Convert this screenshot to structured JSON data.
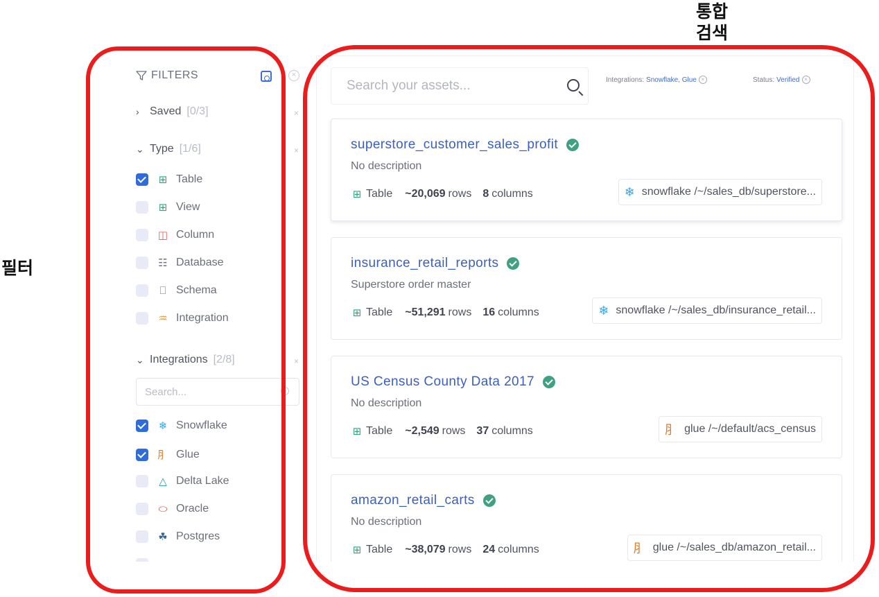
{
  "annotations": {
    "filter_label": "필터",
    "search_label_line1": "통합",
    "search_label_line2": "검색"
  },
  "sidebar": {
    "title": "FILTERS",
    "saved": {
      "label": "Saved",
      "count": "[0/3]"
    },
    "type": {
      "label": "Type",
      "count": "[1/6]",
      "options": [
        {
          "label": "Table",
          "checked": true,
          "icon": "table-icon"
        },
        {
          "label": "View",
          "checked": false,
          "icon": "view-icon"
        },
        {
          "label": "Column",
          "checked": false,
          "icon": "column-icon"
        },
        {
          "label": "Database",
          "checked": false,
          "icon": "database-icon"
        },
        {
          "label": "Schema",
          "checked": false,
          "icon": "schema-icon"
        },
        {
          "label": "Integration",
          "checked": false,
          "icon": "link-icon"
        }
      ]
    },
    "integrations": {
      "label": "Integrations",
      "count": "[2/8]",
      "search_placeholder": "Search...",
      "options": [
        {
          "label": "Snowflake",
          "checked": true,
          "icon": "snowflake-icon"
        },
        {
          "label": "Glue",
          "checked": true,
          "icon": "glue-icon"
        },
        {
          "label": "Delta Lake",
          "checked": false,
          "icon": "delta-icon"
        },
        {
          "label": "Oracle",
          "checked": false,
          "icon": "oracle-icon"
        },
        {
          "label": "Postgres",
          "checked": false,
          "icon": "postgres-icon"
        }
      ]
    }
  },
  "main": {
    "search_placeholder": "Search your assets...",
    "chips": [
      {
        "key": "Integrations:",
        "value": "Snowflake, Glue"
      },
      {
        "key": "Status:",
        "value": "Verified"
      }
    ],
    "results": [
      {
        "title": "superstore_customer_sales_profit",
        "description": "No description",
        "type": "Table",
        "rows": "~20,069",
        "rows_label": "rows",
        "columns": "8",
        "columns_label": "columns",
        "path": "snowflake /~/sales_db/superstore...",
        "path_icon": "snowflake-icon"
      },
      {
        "title": "insurance_retail_reports",
        "description": "Superstore order master",
        "type": "Table",
        "rows": "~51,291",
        "rows_label": "rows",
        "columns": "16",
        "columns_label": "columns",
        "path": "snowflake /~/sales_db/insurance_retail...",
        "path_icon": "snowflake-icon"
      },
      {
        "title": "US Census County Data 2017",
        "description": "No description",
        "type": "Table",
        "rows": "~2,549",
        "rows_label": "rows",
        "columns": "37",
        "columns_label": "columns",
        "path": "glue /~/default/acs_census",
        "path_icon": "glue-icon"
      },
      {
        "title": "amazon_retail_carts",
        "description": "No description",
        "type": "Table",
        "rows": "~38,079",
        "rows_label": "rows",
        "columns": "24",
        "columns_label": "columns",
        "path": "glue /~/sales_db/amazon_retail...",
        "path_icon": "glue-icon"
      }
    ]
  },
  "colors": {
    "accent": "#3b6fd1",
    "link": "#3a5fbf",
    "verified": "#3fa180",
    "annotation": "#ec1c1c"
  }
}
